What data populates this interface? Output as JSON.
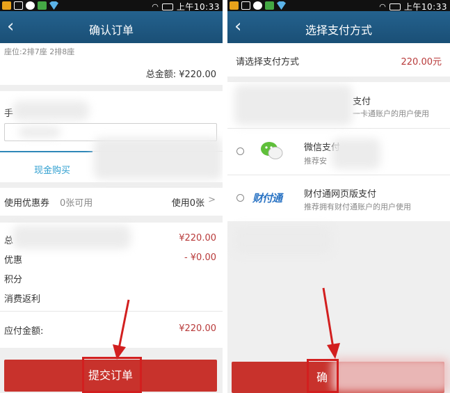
{
  "status_bar": {
    "time": "上午10:33"
  },
  "left": {
    "title": "确认订单",
    "seat_info": "座位:2排7座 2排8座",
    "total_label": "总金额: ¥220.00",
    "phone_label_fragment": "手",
    "tab_cash": "现金购买",
    "coupon_label": "使用优惠券",
    "coupon_available": "0张可用",
    "coupon_used": "使用0张",
    "summary": [
      {
        "label": "总",
        "value": "¥220.00"
      },
      {
        "label": "优惠",
        "value": "- ¥0.00"
      },
      {
        "label": "积分",
        "value": ""
      },
      {
        "label": "消费返利",
        "value": ""
      }
    ],
    "payable_label": "应付金额:",
    "payable_value": "¥220.00",
    "submit_label": "提交订单"
  },
  "right": {
    "title": "选择支付方式",
    "prompt": "请选择支付方式",
    "amount": "220.00元",
    "options": [
      {
        "title": "支付",
        "desc": "一卡通账户的用户使用"
      },
      {
        "title": "微信支付",
        "desc": "推荐安"
      },
      {
        "title": "财付通网页版支付",
        "desc": "推荐拥有财付通账户的用户使用"
      }
    ],
    "tenpay_logo_text": "财付通",
    "confirm_label": "确"
  },
  "colors": {
    "header": "#1e5880",
    "button_red": "#c8322c",
    "price_red": "#b83a3a",
    "tab_blue": "#2f87b8",
    "highlight": "#d21f1f"
  }
}
